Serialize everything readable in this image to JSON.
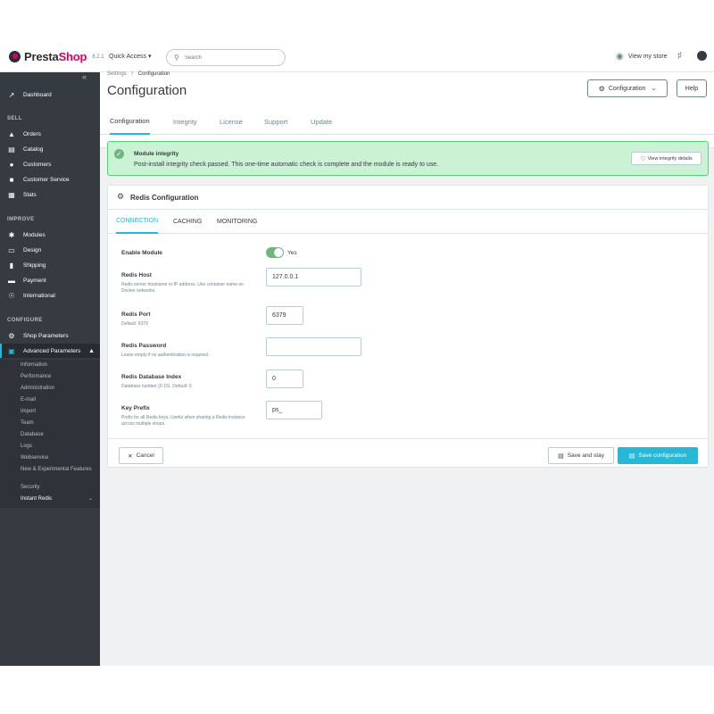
{
  "header": {
    "brand_presta": "Presta",
    "brand_shop": "Shop",
    "version": "8.2.1",
    "quick_access": "Quick Access",
    "search_placeholder": "Search",
    "view_my_store": "View my store"
  },
  "sidebar": {
    "collapse_glyph": "«",
    "dashboard": "Dashboard",
    "sections": [
      "SELL",
      "IMPROVE",
      "CONFIGURE"
    ],
    "sell_items": [
      "Orders",
      "Catalog",
      "Customers",
      "Customer Service",
      "Stats"
    ],
    "improve_items": [
      "Modules",
      "Design",
      "Shipping",
      "Payment",
      "International"
    ],
    "configure_items": [
      "Shop Parameters",
      "Advanced Parameters"
    ],
    "advanced_sub_items": [
      "Information",
      "Performance",
      "Administration",
      "E-mail",
      "Import",
      "Team",
      "Database",
      "Logs",
      "Webservice",
      "New & Experimental Features",
      "Security",
      "Instant Redis"
    ]
  },
  "page": {
    "breadcrumb_parent": "Settings",
    "breadcrumb_sep": "/",
    "breadcrumb_current": "Configuration",
    "title": "Configuration",
    "config_button": "Configuration",
    "help_button": "Help",
    "tabs": [
      "Configuration",
      "Integrity",
      "License",
      "Support",
      "Update"
    ]
  },
  "alert": {
    "title": "Module integrity",
    "text": "Post-install integrity check passed. This one-time automatic check is complete and the module is ready to use.",
    "button": "View integrity details"
  },
  "panel": {
    "title": "Redis Configuration",
    "subtabs": [
      "CONNECTION",
      "CACHING",
      "MONITORING"
    ],
    "fields": {
      "enable_label": "Enable Module",
      "enable_value": "Yes",
      "host_label": "Redis Host",
      "host_help": "Redis server hostname or IP address. Use container name on Docker networks.",
      "host_value": "127.0.0.1",
      "port_label": "Redis Port",
      "port_help": "Default: 6379",
      "port_value": "6379",
      "password_label": "Redis Password",
      "password_help": "Leave empty if no authentication is required.",
      "password_value": "",
      "db_label": "Redis Database Index",
      "db_help": "Database number (0-15). Default: 0",
      "db_value": "0",
      "prefix_label": "Key Prefix",
      "prefix_help": "Prefix for all Redis keys. Useful when sharing a Redis instance across multiple shops.",
      "prefix_value": "ps_"
    },
    "cancel": "Cancel",
    "save_and_stay": "Save and stay",
    "save_configuration": "Save configuration"
  },
  "colors": {
    "accent": "#25b9d7",
    "sidebar_bg": "#363a41",
    "success": "#70b580",
    "brand_pink": "#df0067"
  }
}
